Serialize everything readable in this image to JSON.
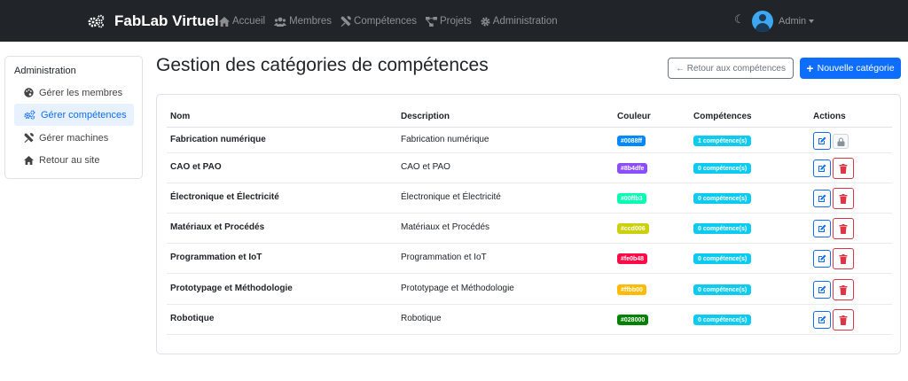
{
  "navbar": {
    "brand": "FabLab Virtuel",
    "links": [
      {
        "label": "Accueil",
        "icon": "home-icon"
      },
      {
        "label": "Membres",
        "icon": "users-icon"
      },
      {
        "label": "Compétences",
        "icon": "tools-icon"
      },
      {
        "label": "Projets",
        "icon": "project-diagram-icon"
      },
      {
        "label": "Administration",
        "icon": "gear-icon"
      }
    ],
    "user": "Admin",
    "theme_icon": "moon-icon"
  },
  "sidebar": {
    "title": "Administration",
    "items": [
      {
        "label": "Gérer les membres",
        "icon": "palette-icon",
        "active": false
      },
      {
        "label": "Gérer compétences",
        "icon": "cogs-icon",
        "active": true
      },
      {
        "label": "Gérer machines",
        "icon": "tools-icon",
        "active": false
      },
      {
        "label": "Retour au site",
        "icon": "home-icon",
        "active": false
      }
    ]
  },
  "page": {
    "title": "Gestion des catégories de compétences",
    "back_button": "← Retour aux compétences",
    "new_button": "Nouvelle catégorie"
  },
  "table": {
    "headers": [
      "Nom",
      "Description",
      "Couleur",
      "Compétences",
      "Actions"
    ],
    "rows": [
      {
        "name": "Fabrication numérique",
        "description": "Fabrication numérique",
        "color": "#0088ff",
        "count": "1 compétence(s)",
        "locked": true
      },
      {
        "name": "CAO et PAO",
        "description": "CAO et PAO",
        "color": "#8b4dfe",
        "count": "0 compétence(s)",
        "locked": false
      },
      {
        "name": "Électronique et Électricité",
        "description": "Électronique et Électricité",
        "color": "#00ffb3",
        "count": "0 compétence(s)",
        "locked": false
      },
      {
        "name": "Matériaux et Procédés",
        "description": "Matériaux et Procédés",
        "color": "#ccd006",
        "count": "0 compétence(s)",
        "locked": false
      },
      {
        "name": "Programmation et IoT",
        "description": "Programmation et IoT",
        "color": "#fe0b48",
        "count": "0 compétence(s)",
        "locked": false
      },
      {
        "name": "Prototypage et Méthodologie",
        "description": "Prototypage et Méthodologie",
        "color": "#ffbb00",
        "count": "0 compétence(s)",
        "locked": false
      },
      {
        "name": "Robotique",
        "description": "Robotique",
        "color": "#028000",
        "count": "0 compétence(s)",
        "locked": false
      }
    ]
  },
  "colors": {
    "navbar_bg": "#212529",
    "primary": "#0d6efd",
    "info": "#0dcaf0",
    "danger": "#dc3545",
    "active_bg": "#e7f1ff"
  }
}
